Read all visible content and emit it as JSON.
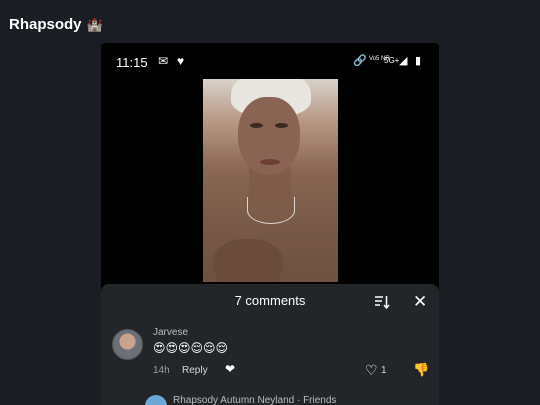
{
  "post": {
    "title": "Rhapsody",
    "title_emoji": "🏰"
  },
  "status_bar": {
    "time": "11:15",
    "net_label": "Vo5 NR",
    "signal": "5G+"
  },
  "comments": {
    "title": "7 comments",
    "items": [
      {
        "user": "Jarvese",
        "text": "😍😍😍😌😌😌",
        "time": "14h",
        "reply_label": "Reply",
        "likes": "1"
      }
    ],
    "reply_preview": {
      "user": "Rhapsody Autumn Neyland · Friends"
    }
  }
}
